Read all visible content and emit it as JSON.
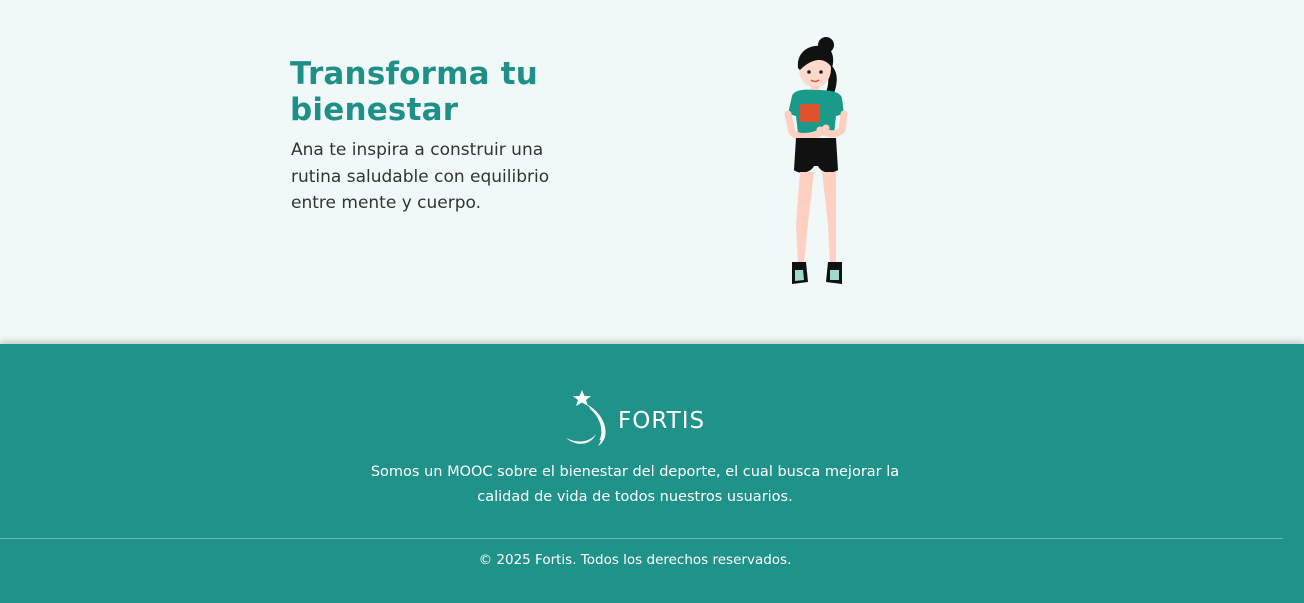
{
  "hero": {
    "title": "Transforma tu bienestar",
    "text": "Ana te inspira a construir una rutina saludable con equilibrio entre mente y cuerpo."
  },
  "footer": {
    "brand": "FORTIS",
    "description": "Somos un MOOC sobre el bienestar del deporte, el cual busca mejorar la calidad de vida de todos nuestros usuarios.",
    "copyright": "© 2025 Fortis. Todos los derechos reservados."
  },
  "colors": {
    "accent": "#1e9088",
    "footer_bg": "#1f9389",
    "hero_bg": "#f1f9f8"
  },
  "icons": {
    "logo": "star-swoosh-icon",
    "illustration": "woman-character-illustration"
  }
}
